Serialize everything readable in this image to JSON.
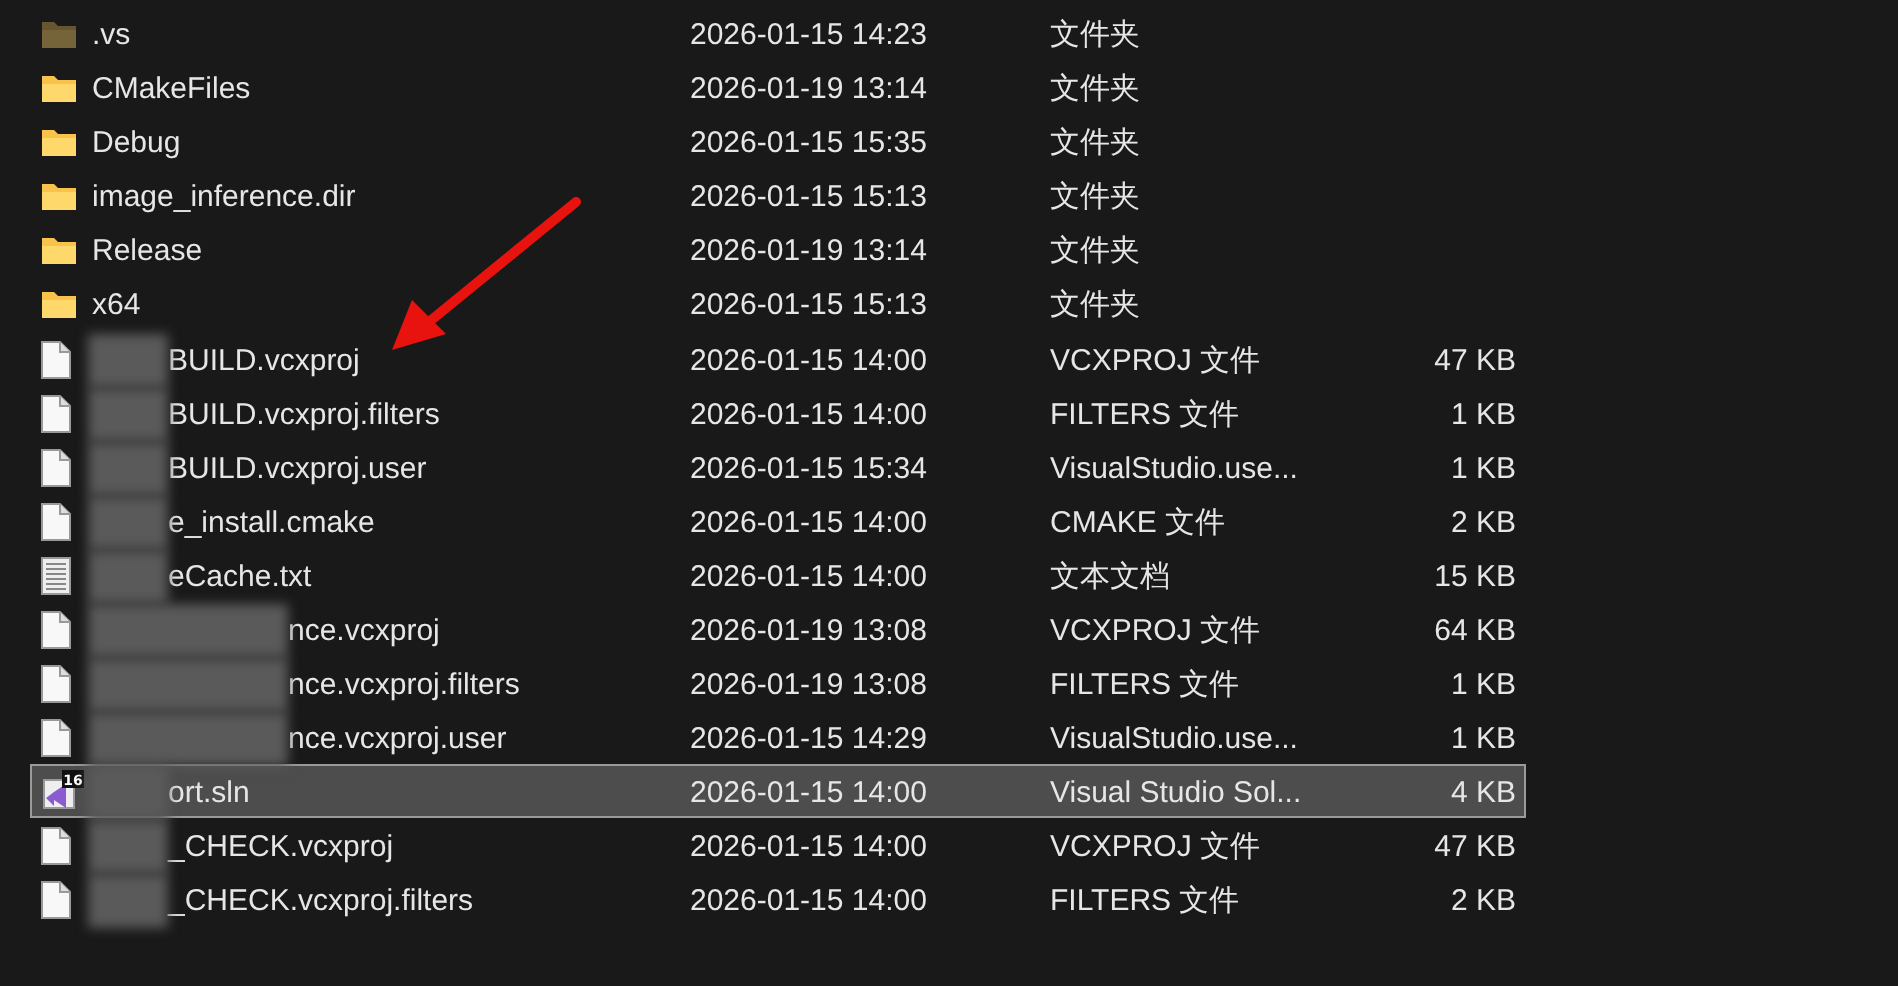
{
  "files": [
    {
      "name": ".vs",
      "modified": "2026-01-15 14:23",
      "type": "文件夹",
      "kind": "folder",
      "hidden": true,
      "selected": false
    },
    {
      "name": "CMakeFiles",
      "modified": "2026-01-19 13:14",
      "type": "文件夹",
      "kind": "folder",
      "hidden": false,
      "selected": false
    },
    {
      "name": "Debug",
      "modified": "2026-01-15 15:35",
      "type": "文件夹",
      "kind": "folder",
      "hidden": false,
      "selected": false
    },
    {
      "name": "image_inference.dir",
      "modified": "2026-01-15 15:13",
      "type": "文件夹",
      "kind": "folder",
      "hidden": false,
      "selected": false
    },
    {
      "name": "Release",
      "modified": "2026-01-19 13:14",
      "type": "文件夹",
      "kind": "folder",
      "hidden": false,
      "selected": false
    },
    {
      "name": "x64",
      "modified": "2026-01-15 15:13",
      "type": "文件夹",
      "kind": "folder",
      "hidden": false,
      "selected": false
    },
    {
      "name": "BUILD.vcxproj",
      "modified": "2026-01-15 14:00",
      "type": "VCXPROJ 文件",
      "size": "47 KB",
      "kind": "file",
      "selected": false,
      "blurred": true,
      "blur_wide": false
    },
    {
      "name": "BUILD.vcxproj.filters",
      "modified": "2026-01-15 14:00",
      "type": "FILTERS 文件",
      "size": "1 KB",
      "kind": "file",
      "selected": false,
      "blurred": true,
      "blur_wide": false
    },
    {
      "name": "BUILD.vcxproj.user",
      "modified": "2026-01-15 15:34",
      "type": "VisualStudio.use...",
      "size": "1 KB",
      "kind": "file",
      "selected": false,
      "blurred": true,
      "blur_wide": false
    },
    {
      "name": "e_install.cmake",
      "modified": "2026-01-15 14:00",
      "type": "CMAKE 文件",
      "size": "2 KB",
      "kind": "file",
      "selected": false,
      "blurred": true,
      "blur_wide": false
    },
    {
      "name": "eCache.txt",
      "modified": "2026-01-15 14:00",
      "type": "文本文档",
      "size": "15 KB",
      "kind": "text",
      "selected": false,
      "blurred": true,
      "blur_wide": false
    },
    {
      "name": "nce.vcxproj",
      "modified": "2026-01-19 13:08",
      "type": "VCXPROJ 文件",
      "size": "64 KB",
      "kind": "file",
      "selected": false,
      "blurred": true,
      "blur_wide": true
    },
    {
      "name": "nce.vcxproj.filters",
      "modified": "2026-01-19 13:08",
      "type": "FILTERS 文件",
      "size": "1 KB",
      "kind": "file",
      "selected": false,
      "blurred": true,
      "blur_wide": true
    },
    {
      "name": "nce.vcxproj.user",
      "modified": "2026-01-15 14:29",
      "type": "VisualStudio.use...",
      "size": "1 KB",
      "kind": "file",
      "selected": false,
      "blurred": true,
      "blur_wide": true
    },
    {
      "name": "ort.sln",
      "modified": "2026-01-15 14:00",
      "type": "Visual Studio Sol...",
      "size": "4 KB",
      "kind": "solution",
      "selected": true,
      "blurred": true,
      "blur_wide": false,
      "badge": "16"
    },
    {
      "name": "_CHECK.vcxproj",
      "modified": "2026-01-15 14:00",
      "type": "VCXPROJ 文件",
      "size": "47 KB",
      "kind": "file",
      "selected": false,
      "blurred": true,
      "blur_wide": false
    },
    {
      "name": "_CHECK.vcxproj.filters",
      "modified": "2026-01-15 14:00",
      "type": "FILTERS 文件",
      "size": "2 KB",
      "kind": "file",
      "selected": false,
      "blurred": true,
      "blur_wide": false
    }
  ]
}
